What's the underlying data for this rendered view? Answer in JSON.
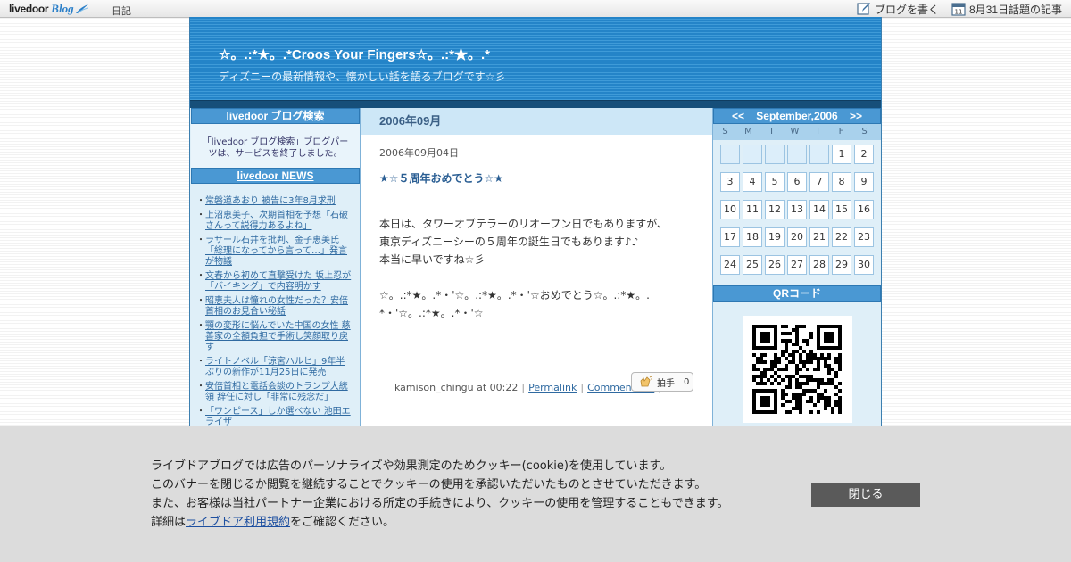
{
  "topbar": {
    "logo_word": "livedoor",
    "logo_blog": "Blog",
    "nikki": "日記",
    "write_blog": "ブログを書く",
    "trending": "8月31日話題の記事",
    "calendar_icon_number": "11"
  },
  "header": {
    "title": "☆。.:*★。.*Croos Your Fingers☆。.:*★。.*",
    "description": "ディズニーの最新情報や、懐かしい話を語るブログです☆彡"
  },
  "left": {
    "search_title": "livedoor ブログ検索",
    "search_text": "「livedoor ブログ検索」ブログパーツは、サービスを終了しました。",
    "news_title": "livedoor NEWS",
    "news": [
      "常磐道あおり 被告に3年8月求刑",
      "上沼恵美子、次期首相を予想「石破さんって説得力あるよね」",
      "ラサール石井を批判、金子恵美氏「総理になってから言って…」発言が物議",
      "文春から初めて直撃受けた 坂上忍が「バイキング」で内容明かす",
      "昭恵夫人は憧れの女性だった？安倍首相のお見合い秘話",
      "顎の変形に悩んでいた中国の女性 慈善家の全額負担で手術し笑顔取り戻す",
      "ライトノベル「涼宮ハルヒ」9年半ぶりの新作が11月25日に発売",
      "安倍首相と電話会談のトランプ大統領 辞任に対し「非常に残念だ」",
      "「ワンピース」しか選べない 池田エライザ"
    ]
  },
  "center": {
    "month": "2006年09月",
    "entry_date": "2006年09月04日",
    "entry_title": "★☆５周年おめでとう☆★",
    "body": [
      "本日は、タワーオブテラーのリオープン日でもありますが、",
      "東京ディズニーシーの５周年の誕生日でもあります♪♪",
      "本当に早いですね☆彡",
      "",
      "☆。.:*★。.*・'☆。.:*★。.*・'☆おめでとう☆。.:*★。.",
      "*・'☆。.:*★。.*・'☆"
    ],
    "author": "kamison_chingu at 00:22",
    "permalink": "Permalink",
    "comments": "Comments(0)",
    "clap_label": "拍手",
    "clap_count": "0"
  },
  "right": {
    "calendar_prev": "<<",
    "calendar_title": "September,2006",
    "calendar_next": ">>",
    "weekdays": [
      "S",
      "M",
      "T",
      "W",
      "T",
      "F",
      "S"
    ],
    "leading_blanks": 5,
    "days": [
      "1",
      "2",
      "3",
      "4",
      "5",
      "6",
      "7",
      "8",
      "9",
      "10",
      "11",
      "12",
      "13",
      "14",
      "15",
      "16",
      "17",
      "18",
      "19",
      "20",
      "21",
      "22",
      "23",
      "24",
      "25",
      "26",
      "27",
      "28",
      "29",
      "30"
    ],
    "qr_title": "QRコード"
  },
  "cookie": {
    "line1": "ライブドアブログでは広告のパーソナライズや効果測定のためクッキー(cookie)を使用しています。",
    "line2": "このバナーを閉じるか閲覧を継続することでクッキーの使用を承認いただいたものとさせていただきます。",
    "line3": "また、お客様は当社パートナー企業における所定の手続きにより、クッキーの使用を管理することもできます。",
    "line4_prefix": "詳細は",
    "line4_link": "ライブドア利用規約",
    "line4_suffix": "をご確認ください。",
    "close_label": "閉じる"
  },
  "colors": {
    "header_blue": "#2e8fd0",
    "sidebar_head": "#4a98d3",
    "link": "#2f6aa1",
    "cookie_button": "#5a5a5a"
  }
}
